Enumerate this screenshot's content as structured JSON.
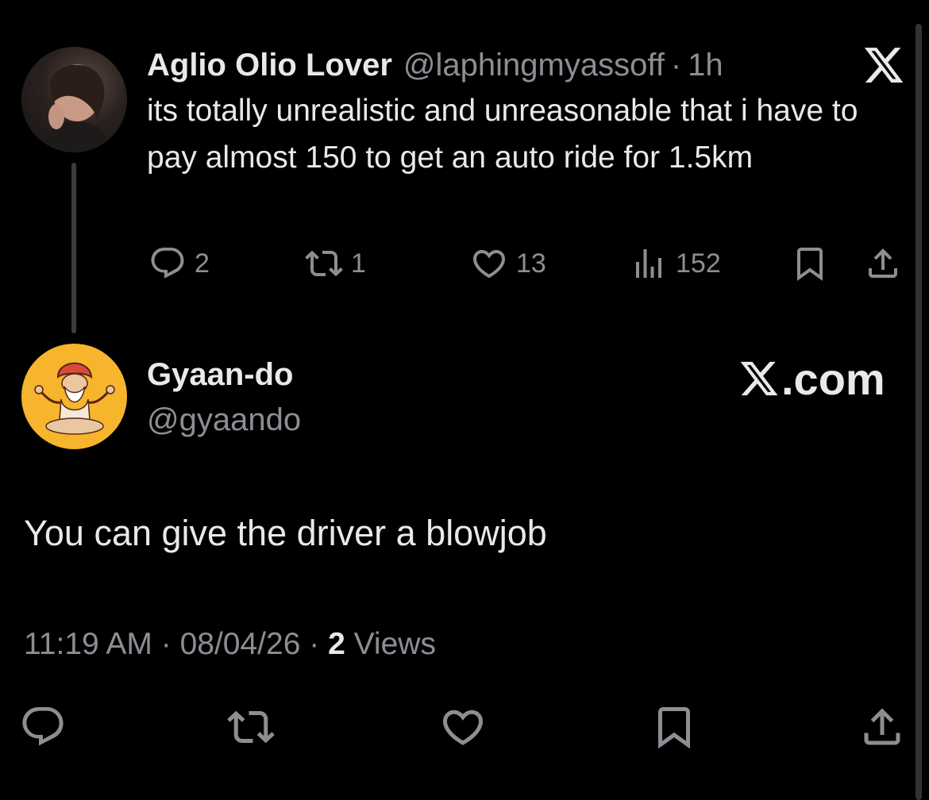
{
  "parent_tweet": {
    "author_name": "Aglio Olio Lover",
    "handle": "@laphingmyassoff",
    "separator": "·",
    "time_ago": "1h",
    "text": "its totally unrealistic and unreasonable that i have to pay almost 150 to get an auto ride for 1.5km",
    "actions": {
      "replies": "2",
      "reposts": "1",
      "likes": "13",
      "views": "152"
    },
    "icons": [
      "reply-icon",
      "repost-icon",
      "like-icon",
      "views-icon",
      "bookmark-icon",
      "share-icon"
    ]
  },
  "reply_tweet": {
    "author_name": "Gyaan-do",
    "handle": "@gyaando",
    "text": "You can give the driver a blowjob",
    "time": "11:19 AM",
    "separator_1": "·",
    "date": "08/04/26",
    "separator_2": "·",
    "views_count": "2",
    "views_label": "Views",
    "icons": [
      "reply-icon",
      "repost-icon",
      "like-icon",
      "bookmark-icon",
      "share-icon"
    ]
  },
  "branding": {
    "logo": "x-logo-icon",
    "text": ".com"
  },
  "colors": {
    "background": "#000000",
    "primary_text": "#e7e9ea",
    "secondary_text": "#8b8f94",
    "avatar_2_bg": "#f6b52c"
  }
}
